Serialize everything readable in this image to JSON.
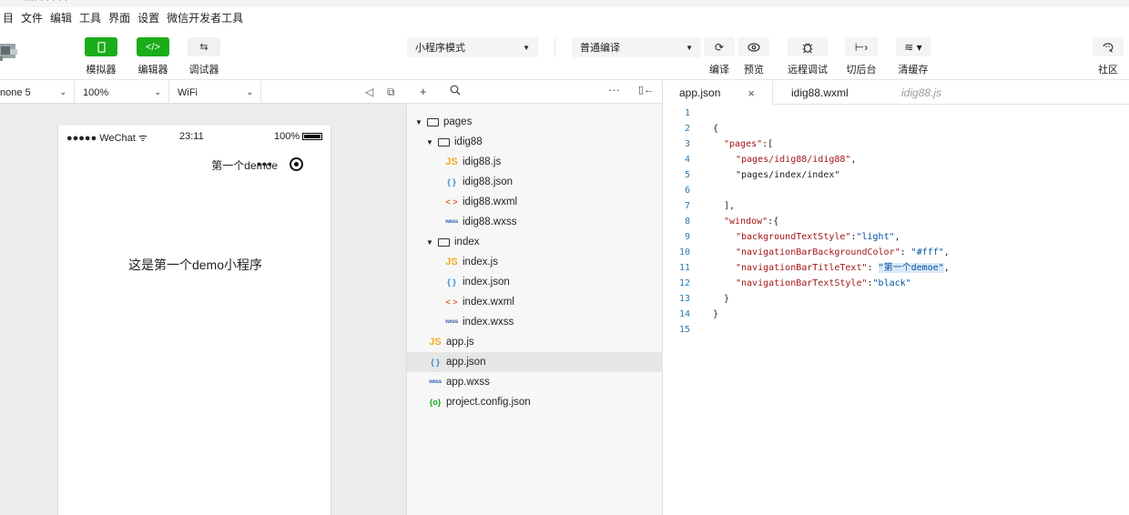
{
  "title_fragment": "···· · · · · ·",
  "menu": {
    "items": [
      "目",
      "文件",
      "编辑",
      "工具",
      "界面",
      "设置",
      "微信开发者工具"
    ]
  },
  "toolbar": {
    "simulator_label": "模拟器",
    "editor_label": "编辑器",
    "debugger_label": "调试器",
    "mode_select": "小程序模式",
    "compile_select": "普通编译",
    "compile_label": "编译",
    "preview_label": "预览",
    "remote_debug_label": "远程调试",
    "background_label": "切后台",
    "clear_cache_label": "清缓存",
    "community_label": "社区"
  },
  "simulator": {
    "device": "none 5",
    "zoom": "100%",
    "network": "WiFi",
    "phone": {
      "carrier": "●●●●● WeChat",
      "time": "23:11",
      "battery": "100%",
      "nav_title": "第一个demoe",
      "more": "•••",
      "content": "这是第一个demo小程序"
    }
  },
  "file_tree": {
    "items": [
      {
        "depth": 0,
        "type": "folder",
        "name": "pages",
        "open": true
      },
      {
        "depth": 1,
        "type": "folder",
        "name": "idig88",
        "open": true
      },
      {
        "depth": 2,
        "type": "js",
        "name": "idig88.js"
      },
      {
        "depth": 2,
        "type": "json",
        "name": "idig88.json"
      },
      {
        "depth": 2,
        "type": "wxml",
        "name": "idig88.wxml"
      },
      {
        "depth": 2,
        "type": "wxss",
        "name": "idig88.wxss"
      },
      {
        "depth": 1,
        "type": "folder",
        "name": "index",
        "open": true
      },
      {
        "depth": 2,
        "type": "js",
        "name": "index.js"
      },
      {
        "depth": 2,
        "type": "json",
        "name": "index.json"
      },
      {
        "depth": 2,
        "type": "wxml",
        "name": "index.wxml"
      },
      {
        "depth": 2,
        "type": "wxss",
        "name": "index.wxss"
      },
      {
        "depth": 0,
        "type": "js",
        "name": "app.js"
      },
      {
        "depth": 0,
        "type": "json",
        "name": "app.json",
        "selected": true
      },
      {
        "depth": 0,
        "type": "wxss",
        "name": "app.wxss"
      },
      {
        "depth": 0,
        "type": "config",
        "name": "project.config.json"
      }
    ],
    "icons": {
      "js": "JS",
      "json": "{ }",
      "wxml": "< >",
      "wxss": "wxss",
      "config": "{o}"
    }
  },
  "editor": {
    "tabs": [
      {
        "label": "app.json",
        "active": true
      },
      {
        "label": "idig88.wxml"
      },
      {
        "label": "idig88.js",
        "italic": true
      }
    ],
    "code": {
      "line_numbers": [
        "1",
        "2",
        "3",
        "4",
        "5",
        "6",
        "7",
        "8",
        "9",
        "10",
        "11",
        "12",
        "13",
        "14",
        "15"
      ],
      "c2": "{",
      "c3_key": "\"pages\"",
      "c3_rest": ":[",
      "c4": "\"pages/idig88/idig88\"",
      "c4_rest": ",",
      "c5": "\"pages/index/index\"",
      "c7": "],",
      "c8_key": "\"window\"",
      "c8_rest": ":{",
      "c9_key": "\"backgroundTextStyle\"",
      "c9_sep": ":",
      "c9_val": "\"light\"",
      "c9_end": ",",
      "c10_key": "\"navigationBarBackgroundColor\"",
      "c10_sep": ": ",
      "c10_val": "\"#fff\"",
      "c10_end": ",",
      "c11_key": "\"navigationBarTitleText\"",
      "c11_sep": ": ",
      "c11_val": "\"第一个demoe\"",
      "c11_end": ",",
      "c12_key": "\"navigationBarTextStyle\"",
      "c12_sep": ":",
      "c12_val": "\"black\"",
      "c13": "}",
      "c14": "}"
    }
  },
  "colors": {
    "accent_green": "#1aad19",
    "line_number": "#2b7bb5",
    "json_key": "#a31515",
    "json_string": "#0451a5"
  }
}
